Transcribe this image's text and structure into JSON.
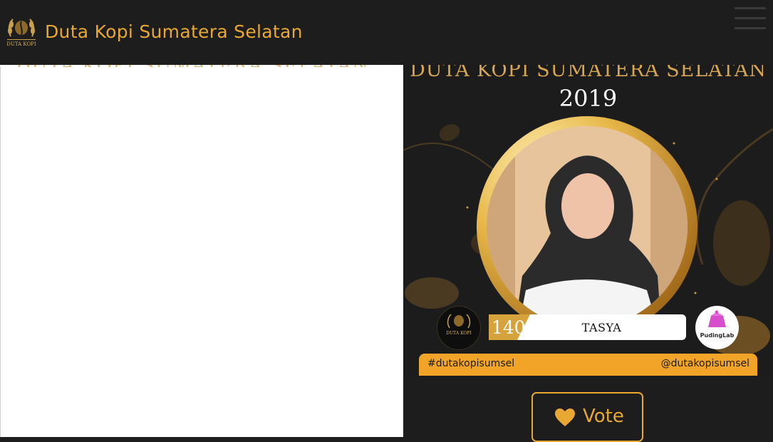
{
  "navbar": {
    "title": "Duta Kopi Sumatera Selatan",
    "logo_text": "DUTA KOPI"
  },
  "card": {
    "heading": "Duta Kopi Sumatera Selatan",
    "year": "2019",
    "contestant_number": "140",
    "contestant_name": "TASYA",
    "badge_text": "DUTA KOPI",
    "sponsor_name": "PudingLab",
    "hashtag": "#dutakopisumsel",
    "handle": "@dutakopisumsel"
  },
  "vote": {
    "label": "Vote",
    "icon": "heart-icon"
  },
  "colors": {
    "accent": "#e8a832",
    "navbar_bg": "#1d1d1d",
    "hashtag_bar": "#f2a428"
  }
}
